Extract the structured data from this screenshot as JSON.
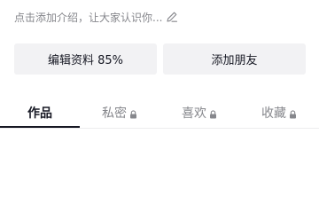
{
  "profile": {
    "intro_placeholder": "点击添加介绍，让大家认识你...",
    "edit_icon": "pencil-icon"
  },
  "actions": {
    "edit_profile_label": "编辑资料 85%",
    "add_friends_label": "添加朋友"
  },
  "tabs": [
    {
      "label": "作品",
      "active": true,
      "locked": false
    },
    {
      "label": "私密",
      "active": false,
      "locked": true
    },
    {
      "label": "喜欢",
      "active": false,
      "locked": true
    },
    {
      "label": "收藏",
      "active": false,
      "locked": true
    }
  ],
  "colors": {
    "text_primary": "#161823",
    "text_secondary": "#86878c",
    "button_bg": "#f2f2f4",
    "divider": "#ededee"
  }
}
